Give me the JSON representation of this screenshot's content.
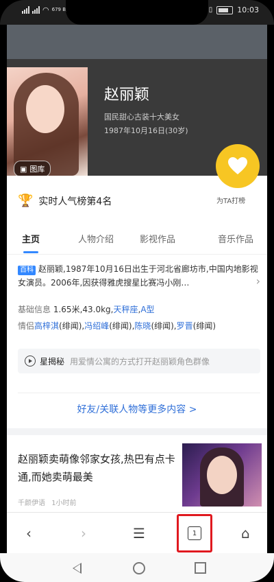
{
  "status_bar": {
    "time": "10:03",
    "net_speed": "679 B/s"
  },
  "profile": {
    "name": "赵丽颖",
    "tagline": "国民甜心古装十大美女",
    "birth": "1987年10月16日(30岁)",
    "gallery_label": "图库",
    "vote_label": "为TA打榜",
    "rank_text": "实时人气榜第4名"
  },
  "tabs": [
    {
      "label": "主页"
    },
    {
      "label": "人物介绍"
    },
    {
      "label": "影视作品"
    },
    {
      "label": "音乐作品"
    }
  ],
  "summary": {
    "badge": "百科",
    "text": "赵丽颖,1987年10月16日出生于河北省廊坊市,中国内地影视女演员。2006年,因获得雅虎搜星比赛冯小刚…"
  },
  "basic_info": {
    "label": "基础信息",
    "plain": "1.65米,43.0kg,",
    "link1": "天秤座",
    "sep": ",",
    "link2": "A型"
  },
  "relations": {
    "label": "情侣",
    "items": [
      {
        "name": "高梓淇",
        "note": "(绯闻),"
      },
      {
        "name": "冯绍峰",
        "note": "(绯闻),"
      },
      {
        "name": "陈晓",
        "note": "(绯闻),"
      },
      {
        "name": "罗晋",
        "note": "(绯闻)"
      }
    ]
  },
  "discover": {
    "label": "星揭秘",
    "text": "用爱情公寓的方式打开赵丽颖角色群像"
  },
  "more_link": "好友/关联人物等更多内容 >",
  "news": {
    "title": "赵丽颖卖萌像邻家女孩,热巴有点卡通,而她卖萌最美",
    "source": "千颜伊语",
    "time": "1小时前"
  },
  "browser_bar": {
    "back": "‹",
    "forward": "›",
    "menu": "☰",
    "tab_count": "1",
    "home": "⌂"
  },
  "colors": {
    "accent_blue": "#2f6fd8",
    "vote_yellow": "#f7c623",
    "highlight_red": "#e0191f"
  }
}
